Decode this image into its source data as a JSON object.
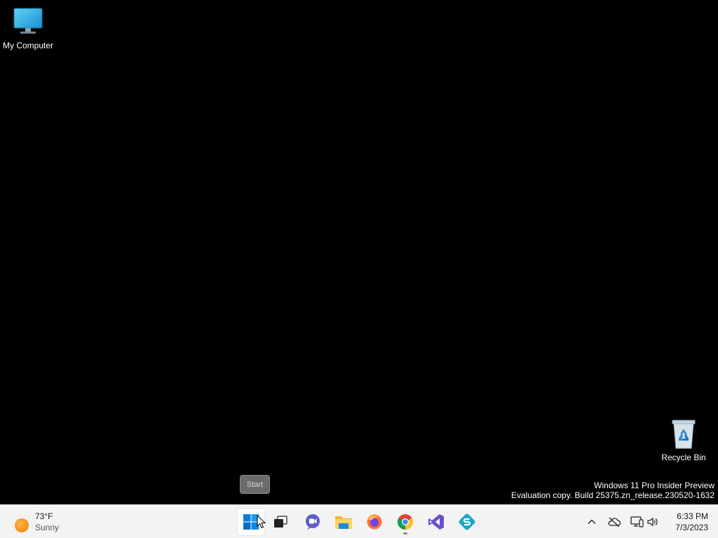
{
  "desktop": {
    "icons": [
      {
        "label": "My Computer",
        "icon": "monitor-icon"
      },
      {
        "label": "Recycle Bin",
        "icon": "recycle-bin-icon"
      }
    ],
    "watermark": {
      "line1": "Windows 11 Pro Insider Preview",
      "line2": "Evaluation copy. Build 25375.zn_release.230520-1632"
    },
    "tooltip": "Start"
  },
  "taskbar": {
    "weather": {
      "temp": "73°F",
      "condition": "Sunny",
      "icon": "sun-icon"
    },
    "pinned": [
      {
        "name": "start-button",
        "icon": "windows-logo-icon",
        "active": true
      },
      {
        "name": "task-view-button",
        "icon": "task-view-icon"
      },
      {
        "name": "teams-chat-button",
        "icon": "chat-icon"
      },
      {
        "name": "file-explorer-button",
        "icon": "folder-icon"
      },
      {
        "name": "firefox-button",
        "icon": "firefox-icon"
      },
      {
        "name": "chrome-button",
        "icon": "chrome-icon",
        "running": true
      },
      {
        "name": "visual-studio-button",
        "icon": "visual-studio-icon"
      },
      {
        "name": "app-button",
        "icon": "app-s-icon"
      }
    ],
    "tray": {
      "icons": [
        "chevron-up-icon",
        "onedrive-offline-icon",
        "network-icon",
        "volume-icon"
      ],
      "time": "6:33 PM",
      "date": "7/3/2023"
    },
    "colors": {
      "background": "#f3f3f3",
      "accent": "#0078d4"
    }
  }
}
